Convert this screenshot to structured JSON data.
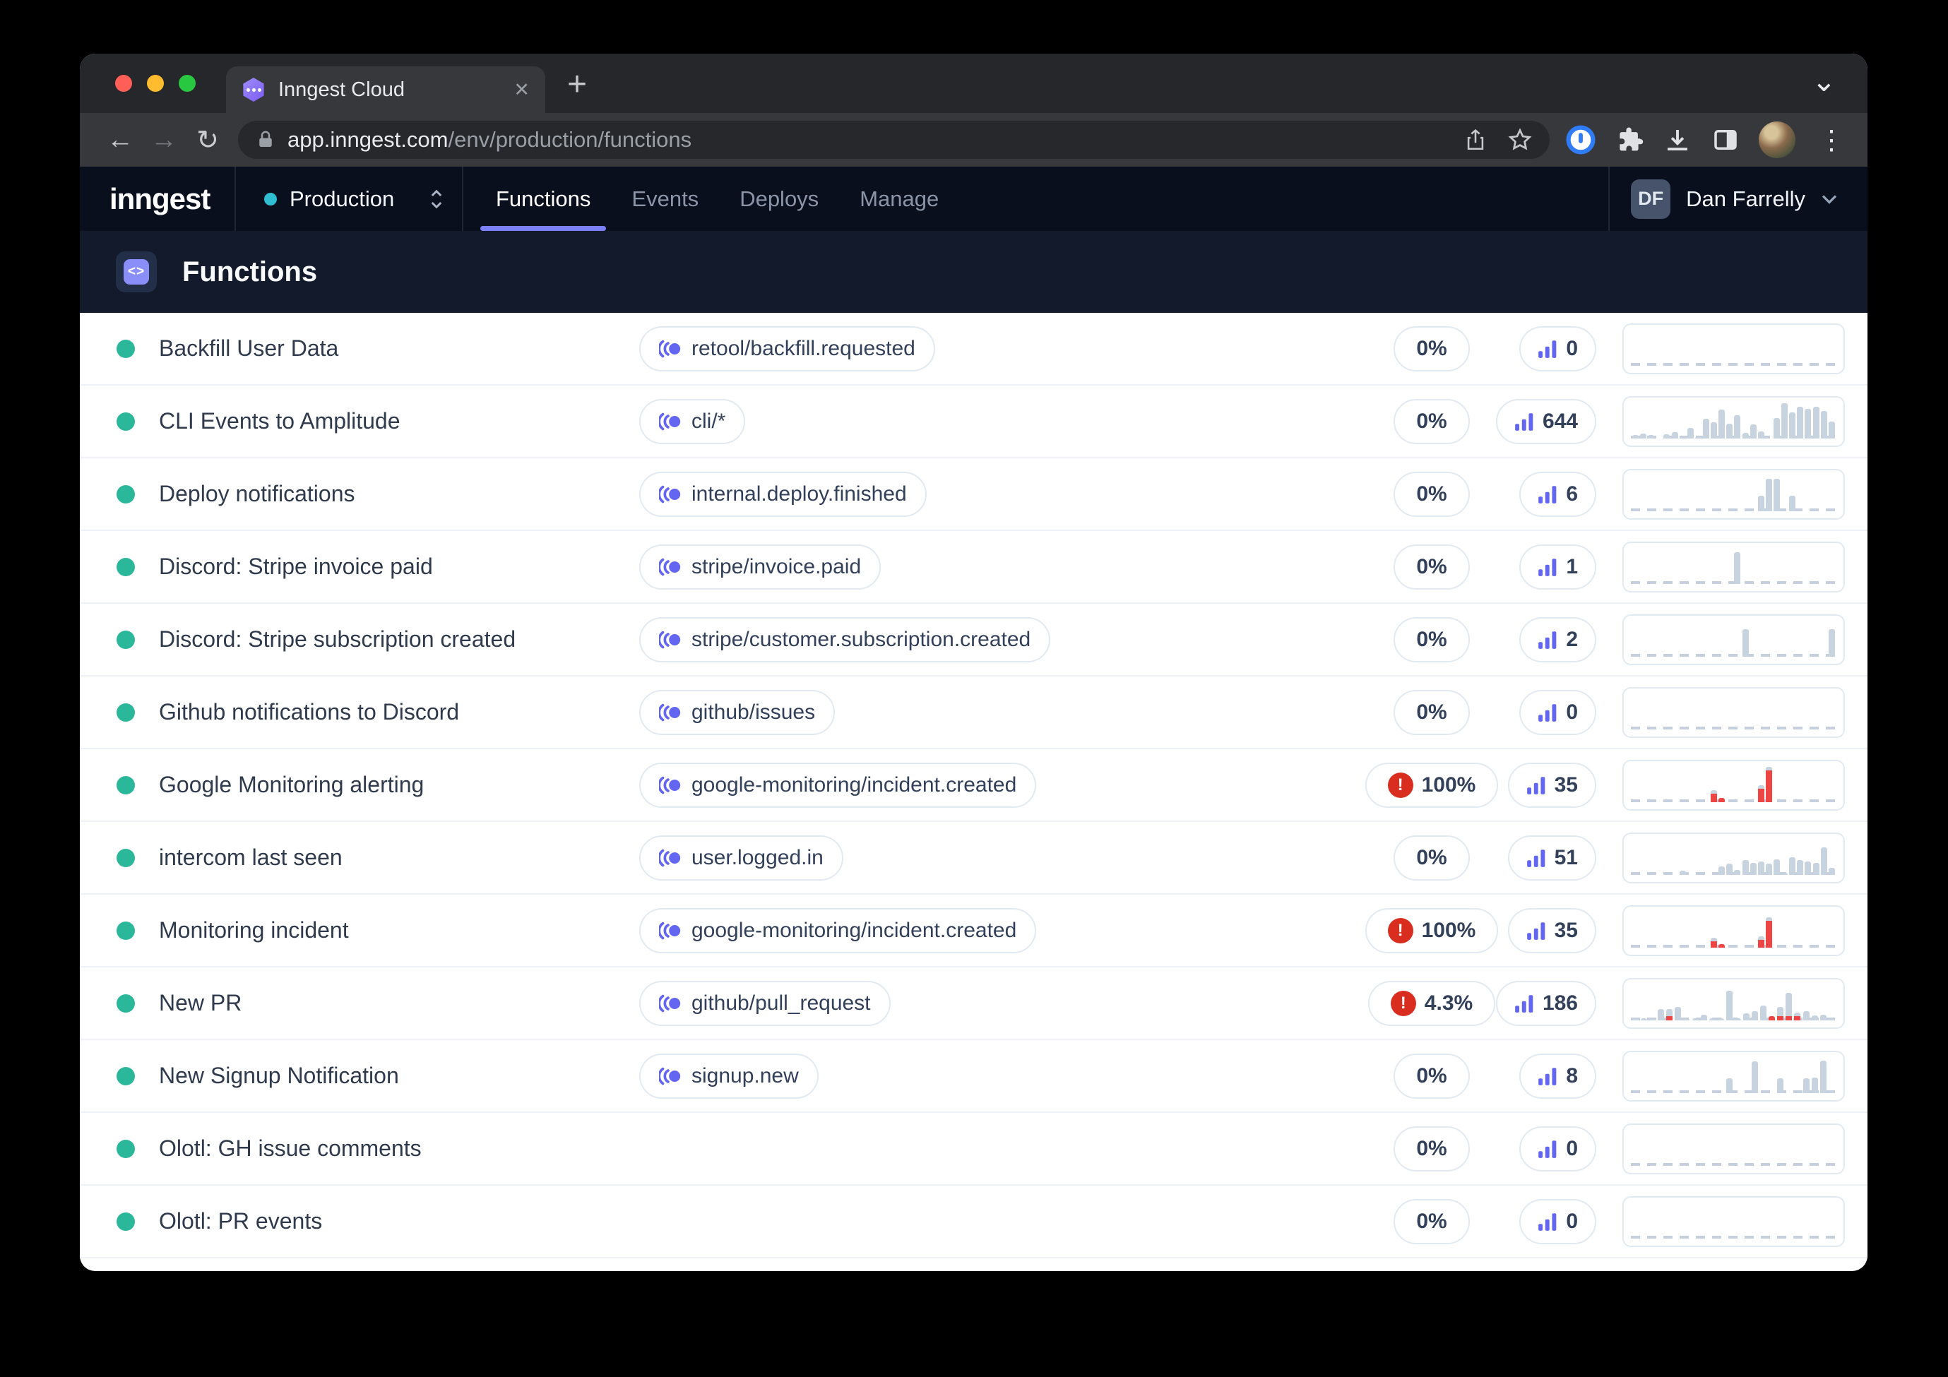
{
  "colors": {
    "accent": "#7c80f6",
    "teal": "#2bb89a",
    "red": "#d92d20",
    "bar_gray": "#c8d3e0",
    "bar_red": "#ef4444",
    "purple": "#6366f1"
  },
  "icons": {
    "back": "←",
    "forward": "→",
    "reload": "↻",
    "plus": "+",
    "close": "✕",
    "kebab": "⋮",
    "window_chevron": "⌄",
    "code": "<>",
    "event_icon": "event-trigger-waves",
    "bars_icon": "run-count-bars",
    "error_icon": "!"
  },
  "chrome": {
    "tab_title": "Inngest Cloud",
    "url_host": "app.inngest.com",
    "url_path": "/env/production/functions"
  },
  "header": {
    "brand": "inngest",
    "env_label": "Production",
    "nav": [
      "Functions",
      "Events",
      "Deploys",
      "Manage"
    ],
    "active_nav": "Functions",
    "user_initials": "DF",
    "user_name": "Dan Farrelly"
  },
  "page": {
    "title": "Functions"
  },
  "rows": [
    {
      "name": "Backfill User Data",
      "event": "retool/backfill.requested",
      "pct": "0%",
      "error": false,
      "count": "0",
      "bars": []
    },
    {
      "name": "CLI Events to Amplitude",
      "event": "cli/*",
      "pct": "0%",
      "error": false,
      "count": "644",
      "bars": [
        8,
        12,
        8,
        0,
        10,
        16,
        0,
        28,
        4,
        52,
        44,
        78,
        40,
        62,
        15,
        38,
        18,
        0,
        55,
        95,
        70,
        85,
        80,
        85,
        75,
        45
      ]
    },
    {
      "name": "Deploy notifications",
      "event": "internal.deploy.finished",
      "pct": "0%",
      "error": false,
      "count": "6",
      "bars": [
        0,
        0,
        0,
        0,
        0,
        0,
        0,
        0,
        0,
        0,
        0,
        0,
        0,
        0,
        0,
        0,
        42,
        88,
        88,
        0,
        42,
        0,
        0,
        0,
        0,
        0
      ]
    },
    {
      "name": "Discord: Stripe invoice paid",
      "event": "stripe/invoice.paid",
      "pct": "0%",
      "error": false,
      "count": "1",
      "bars": [
        0,
        0,
        0,
        0,
        0,
        0,
        0,
        0,
        0,
        0,
        0,
        0,
        0,
        85,
        0,
        0,
        0,
        0,
        0,
        0,
        0,
        0,
        0,
        0,
        0,
        0
      ]
    },
    {
      "name": "Discord: Stripe subscription created",
      "event": "stripe/customer.subscription.created",
      "pct": "0%",
      "error": false,
      "count": "2",
      "bars": [
        0,
        0,
        0,
        0,
        0,
        0,
        0,
        0,
        0,
        0,
        0,
        0,
        0,
        0,
        75,
        0,
        0,
        0,
        0,
        0,
        0,
        0,
        0,
        0,
        0,
        75
      ]
    },
    {
      "name": "Github notifications to Discord",
      "event": "github/issues",
      "pct": "0%",
      "error": false,
      "count": "0",
      "bars": []
    },
    {
      "name": "Google Monitoring alerting",
      "event": "google-monitoring/incident.created",
      "pct": "100%",
      "error": true,
      "count": "35",
      "bars": [
        0,
        0,
        0,
        0,
        0,
        0,
        0,
        0,
        0,
        0,
        [
          32,
          "rc"
        ],
        [
          10,
          "r"
        ],
        0,
        0,
        0,
        0,
        [
          45,
          "rc"
        ],
        [
          95,
          "rc"
        ],
        0,
        0,
        0,
        0,
        0,
        0,
        0,
        0
      ]
    },
    {
      "name": "intercom last seen",
      "event": "user.logged.in",
      "pct": "0%",
      "error": false,
      "count": "51",
      "bars": [
        0,
        0,
        0,
        0,
        0,
        0,
        10,
        0,
        0,
        0,
        0,
        22,
        30,
        12,
        40,
        32,
        35,
        30,
        42,
        4,
        48,
        40,
        35,
        32,
        75,
        18
      ]
    },
    {
      "name": "Monitoring incident",
      "event": "google-monitoring/incident.created",
      "pct": "100%",
      "error": true,
      "count": "35",
      "bars": [
        0,
        0,
        0,
        0,
        0,
        0,
        0,
        0,
        0,
        0,
        [
          26,
          "rc"
        ],
        [
          8,
          "r"
        ],
        0,
        0,
        0,
        0,
        [
          30,
          "rc"
        ],
        [
          82,
          "rc"
        ],
        0,
        0,
        0,
        0,
        0,
        0,
        0,
        0
      ]
    },
    {
      "name": "New PR",
      "event": "github/pull_request",
      "pct": "4.3%",
      "error": true,
      "count": "186",
      "bars": [
        4,
        4,
        4,
        30,
        [
          30,
          "gr"
        ],
        36,
        4,
        4,
        15,
        4,
        4,
        80,
        4,
        18,
        25,
        40,
        [
          10,
          "r"
        ],
        [
          35,
          "gr"
        ],
        [
          75,
          "gr"
        ],
        [
          20,
          "gr"
        ],
        25,
        12,
        15,
        4
      ]
    },
    {
      "name": "New Signup Notification",
      "event": "signup.new",
      "pct": "0%",
      "error": false,
      "count": "8",
      "bars": [
        0,
        0,
        0,
        0,
        0,
        0,
        0,
        0,
        0,
        0,
        0,
        40,
        0,
        0,
        85,
        0,
        0,
        40,
        0,
        0,
        40,
        42,
        88,
        4
      ]
    },
    {
      "name": "Olotl: GH issue comments",
      "event": null,
      "pct": "0%",
      "error": false,
      "count": "0",
      "bars": []
    },
    {
      "name": "Olotl: PR events",
      "event": null,
      "pct": "0%",
      "error": false,
      "count": "0",
      "bars": []
    }
  ]
}
